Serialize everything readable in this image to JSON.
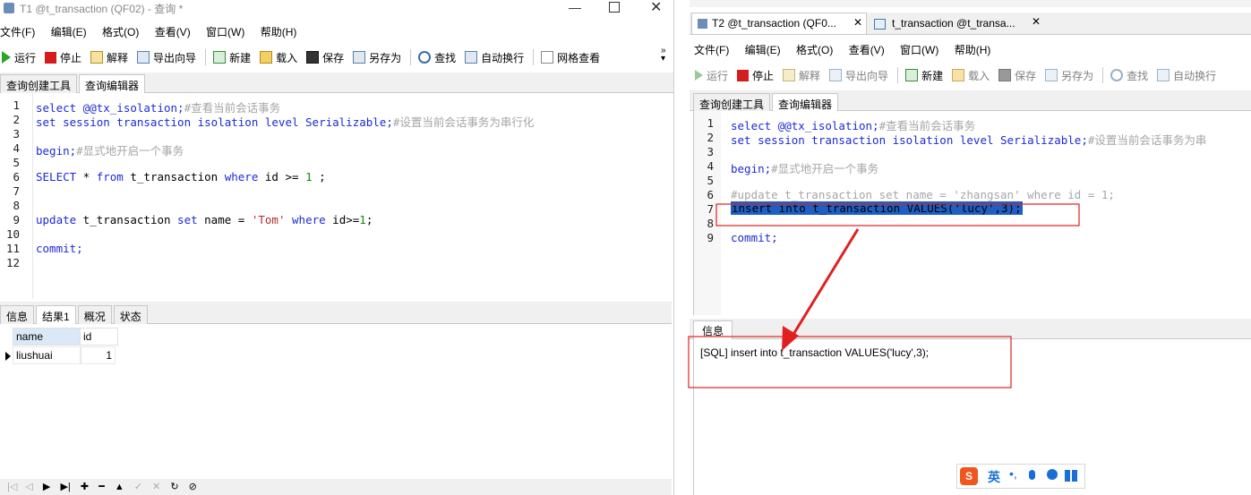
{
  "left": {
    "title": "T1 @t_transaction (QF02) - 查询 *",
    "menu": [
      "文件(F)",
      "编辑(E)",
      "格式(O)",
      "查看(V)",
      "窗口(W)",
      "帮助(H)"
    ],
    "toolbar": [
      "运行",
      "停止",
      "解释",
      "导出向导",
      "新建",
      "载入",
      "保存",
      "另存为",
      "查找",
      "自动换行",
      "网格查看"
    ],
    "tabs": [
      "查询创建工具",
      "查询编辑器"
    ],
    "line_numbers": [
      "1",
      "2",
      "3",
      "4",
      "5",
      "6",
      "7",
      "8",
      "9",
      "10",
      "11",
      "12"
    ],
    "code": {
      "l1a": "select @@tx_isolation;",
      "l1b": "#查看当前会话事务",
      "l2a": "set session transaction isolation level Serializable;",
      "l2b": "#设置当前会话事务为串行化",
      "l4a": "begin;",
      "l4b": "#显式地开启一个事务",
      "l6": "SELECT * from t_transaction where id >= 1 ;",
      "l9": "update t_transaction set name = 'Tom' where id>=1;",
      "l11": "commit;"
    },
    "result_tabs": [
      "信息",
      "结果1",
      "概况",
      "状态"
    ],
    "grid": {
      "columns": [
        "name",
        "id"
      ],
      "rows": [
        [
          "liushuai",
          "1"
        ]
      ]
    }
  },
  "right": {
    "top_tabs": [
      "T2 @t_transaction (QF0...",
      "t_transaction @t_transa..."
    ],
    "menu": [
      "文件(F)",
      "编辑(E)",
      "格式(O)",
      "查看(V)",
      "窗口(W)",
      "帮助(H)"
    ],
    "toolbar": [
      "运行",
      "停止",
      "解释",
      "导出向导",
      "新建",
      "载入",
      "保存",
      "另存为",
      "查找",
      "自动换行"
    ],
    "tabs": [
      "查询创建工具",
      "查询编辑器"
    ],
    "line_numbers": [
      "1",
      "2",
      "3",
      "4",
      "5",
      "6",
      "7",
      "8",
      "9"
    ],
    "code": {
      "l1a": "select @@tx_isolation;",
      "l1b": "#查看当前会话事务",
      "l2a": "set session transaction isolation level Serializable;",
      "l2b": "#设置当前会话事务为串",
      "l4a": "begin;",
      "l4b": "#显式地开启一个事务",
      "l6": "#update t_transaction set name = 'zhangsan' where id = 1;",
      "l7": "insert into t_transaction VALUES('lucy',3);",
      "l9": "commit;"
    },
    "info_tab": "信息",
    "info_text": "[SQL] insert into t_transaction VALUES('lucy',3);",
    "ime": "英"
  },
  "colors": {
    "annotation": "#e02020",
    "selection": "#1e5fc4",
    "keyword": "#1d2bd6"
  }
}
